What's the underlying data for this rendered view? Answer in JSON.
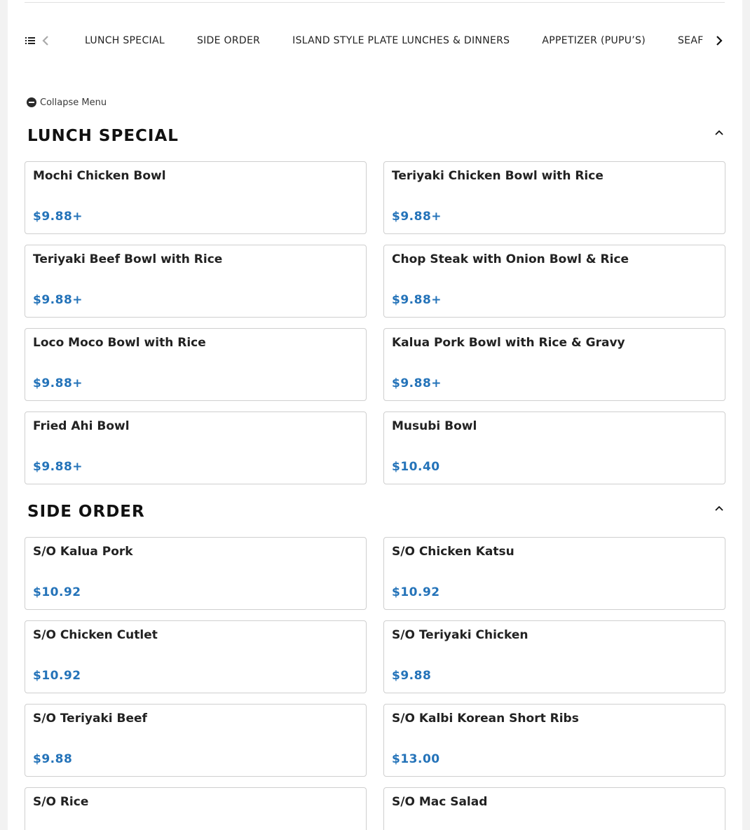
{
  "nav": {
    "categories": [
      "LUNCH SPECIAL",
      "SIDE ORDER",
      "ISLAND STYLE PLATE LUNCHES & DINNERS",
      "APPETIZER (PUPU’S)",
      "SEAFOOD"
    ]
  },
  "collapse_label": "Collapse Menu",
  "sections": [
    {
      "title": "LUNCH SPECIAL",
      "items": [
        {
          "name": "Mochi Chicken Bowl",
          "price": "$9.88+"
        },
        {
          "name": "Teriyaki Chicken Bowl with Rice",
          "price": "$9.88+"
        },
        {
          "name": "Teriyaki Beef Bowl with Rice",
          "price": "$9.88+"
        },
        {
          "name": "Chop Steak with Onion Bowl & Rice",
          "price": "$9.88+"
        },
        {
          "name": "Loco Moco Bowl with Rice",
          "price": "$9.88+"
        },
        {
          "name": "Kalua Pork Bowl with Rice & Gravy",
          "price": "$9.88+"
        },
        {
          "name": "Fried Ahi Bowl",
          "price": "$9.88+"
        },
        {
          "name": "Musubi Bowl",
          "price": "$10.40"
        }
      ]
    },
    {
      "title": "SIDE ORDER",
      "items": [
        {
          "name": "S/O Kalua Pork",
          "price": "$10.92"
        },
        {
          "name": "S/O Chicken Katsu",
          "price": "$10.92"
        },
        {
          "name": "S/O Chicken Cutlet",
          "price": "$10.92"
        },
        {
          "name": "S/O Teriyaki Chicken",
          "price": "$9.88"
        },
        {
          "name": "S/O Teriyaki Beef",
          "price": "$9.88"
        },
        {
          "name": "S/O Kalbi Korean Short Ribs",
          "price": "$13.00"
        },
        {
          "name": "S/O Rice",
          "price": ""
        },
        {
          "name": "S/O Mac Salad",
          "price": ""
        }
      ]
    }
  ],
  "colors": {
    "price": "#2473b9",
    "border": "#cfcfcf"
  },
  "icons": [
    "list-icon",
    "chevron-left-icon",
    "chevron-right-icon",
    "minus-circle-icon",
    "chevron-up-icon"
  ]
}
